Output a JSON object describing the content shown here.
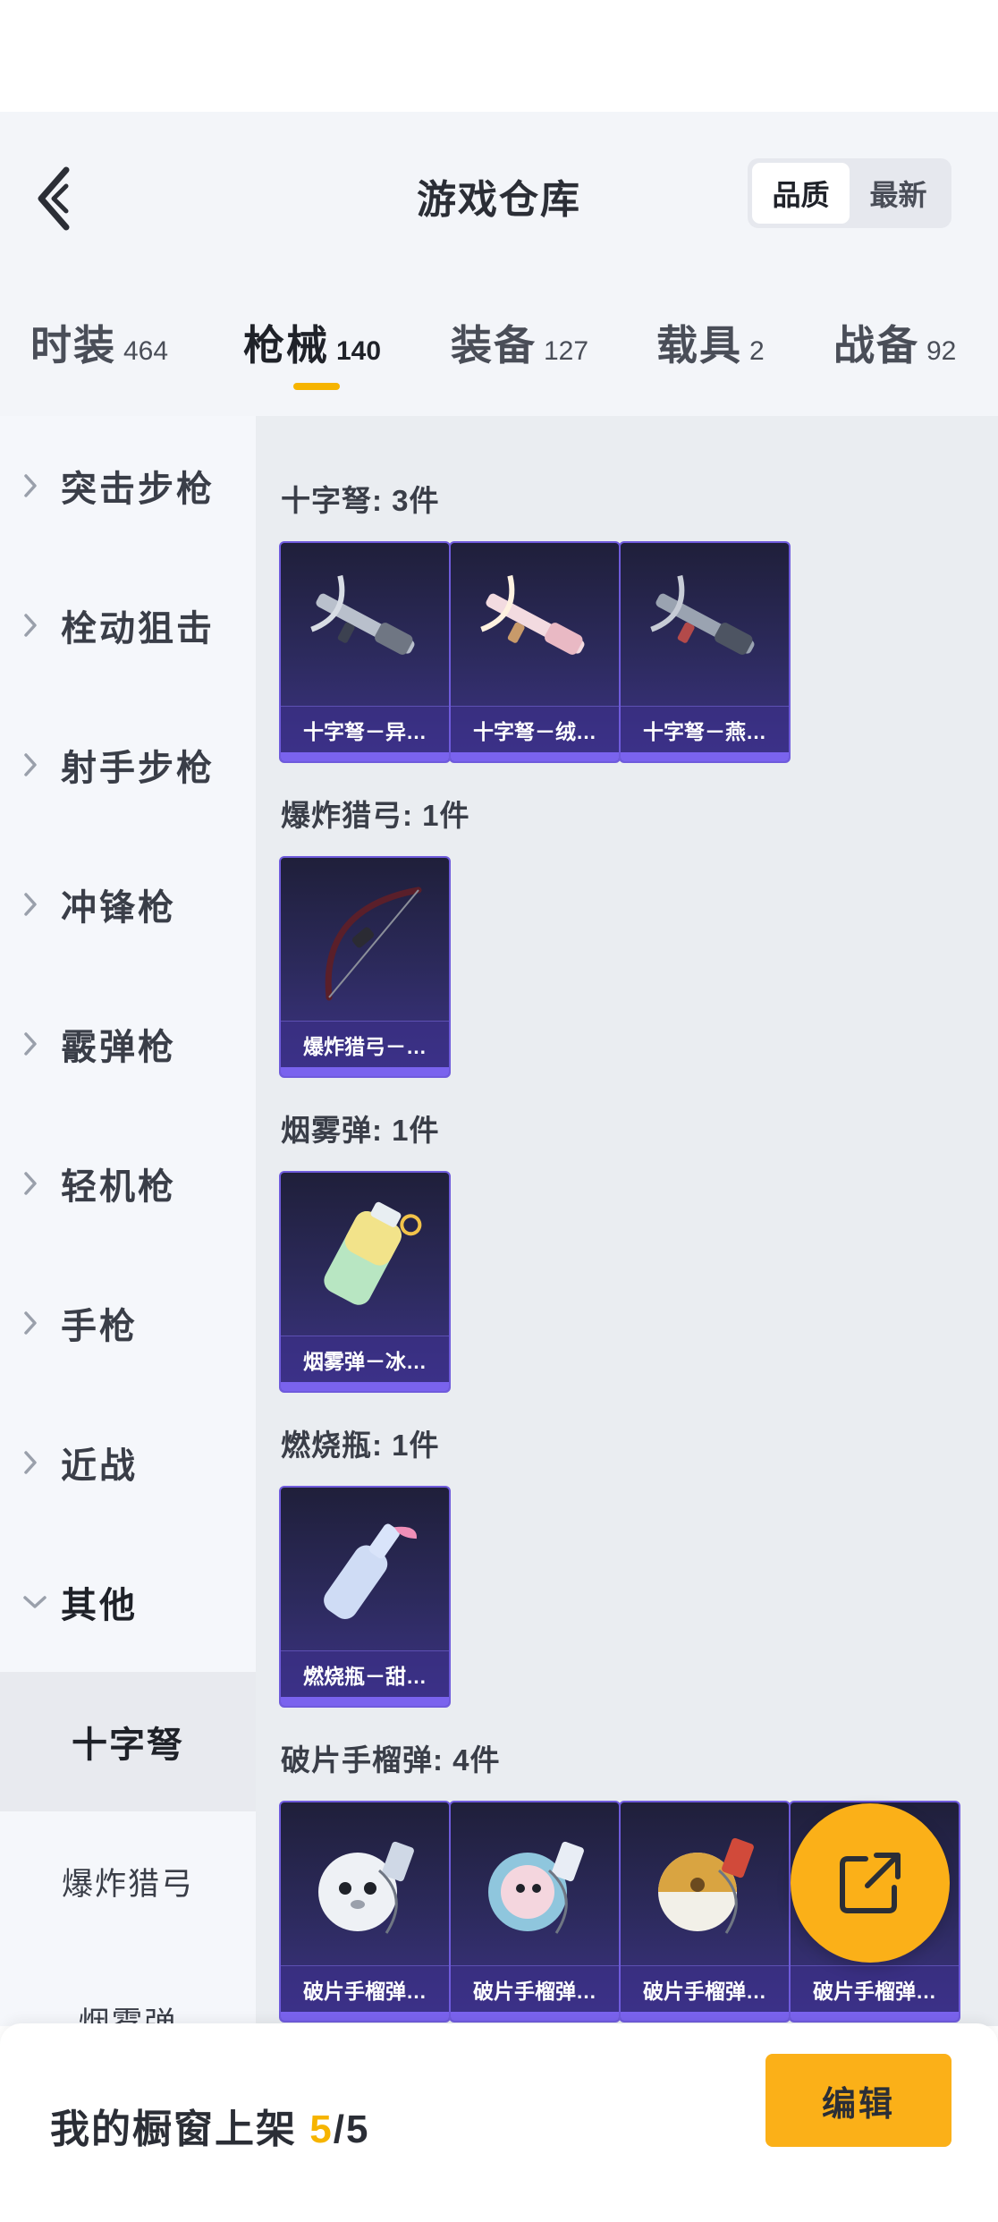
{
  "header": {
    "title": "游戏仓库",
    "sort_options": [
      "品质",
      "最新"
    ]
  },
  "tabs": [
    {
      "label": "时装",
      "count": "464"
    },
    {
      "label": "枪械",
      "count": "140"
    },
    {
      "label": "装备",
      "count": "127"
    },
    {
      "label": "载具",
      "count": "2"
    },
    {
      "label": "战备",
      "count": "92"
    }
  ],
  "sidebar": {
    "categories": [
      "突击步枪",
      "栓动狙击",
      "射手步枪",
      "冲锋枪",
      "霰弹枪",
      "轻机枪",
      "手枪",
      "近战",
      "其他"
    ],
    "subitems": [
      "十字弩",
      "爆炸猎弓",
      "烟雾弹"
    ]
  },
  "sections": [
    {
      "title": "十字弩: 3件",
      "items": [
        "十字弩－异…",
        "十字弩－绒…",
        "十字弩－燕…"
      ]
    },
    {
      "title": "爆炸猎弓: 1件",
      "items": [
        "爆炸猎弓－…"
      ]
    },
    {
      "title": "烟雾弹: 1件",
      "items": [
        "烟雾弹－冰…"
      ]
    },
    {
      "title": "燃烧瓶: 1件",
      "items": [
        "燃烧瓶－甜…"
      ]
    },
    {
      "title": "破片手榴弹: 4件",
      "items": [
        "破片手榴弹…",
        "破片手榴弹…",
        "破片手榴弹…",
        "破片手榴弹…"
      ]
    }
  ],
  "bottom": {
    "label": "我的橱窗上架",
    "count": "5",
    "total": "/5",
    "edit_label": "编辑"
  },
  "colors": {
    "accent": "#f6b400",
    "card_border": "#6f5bdc",
    "card_bg": "#2c2a5c"
  }
}
